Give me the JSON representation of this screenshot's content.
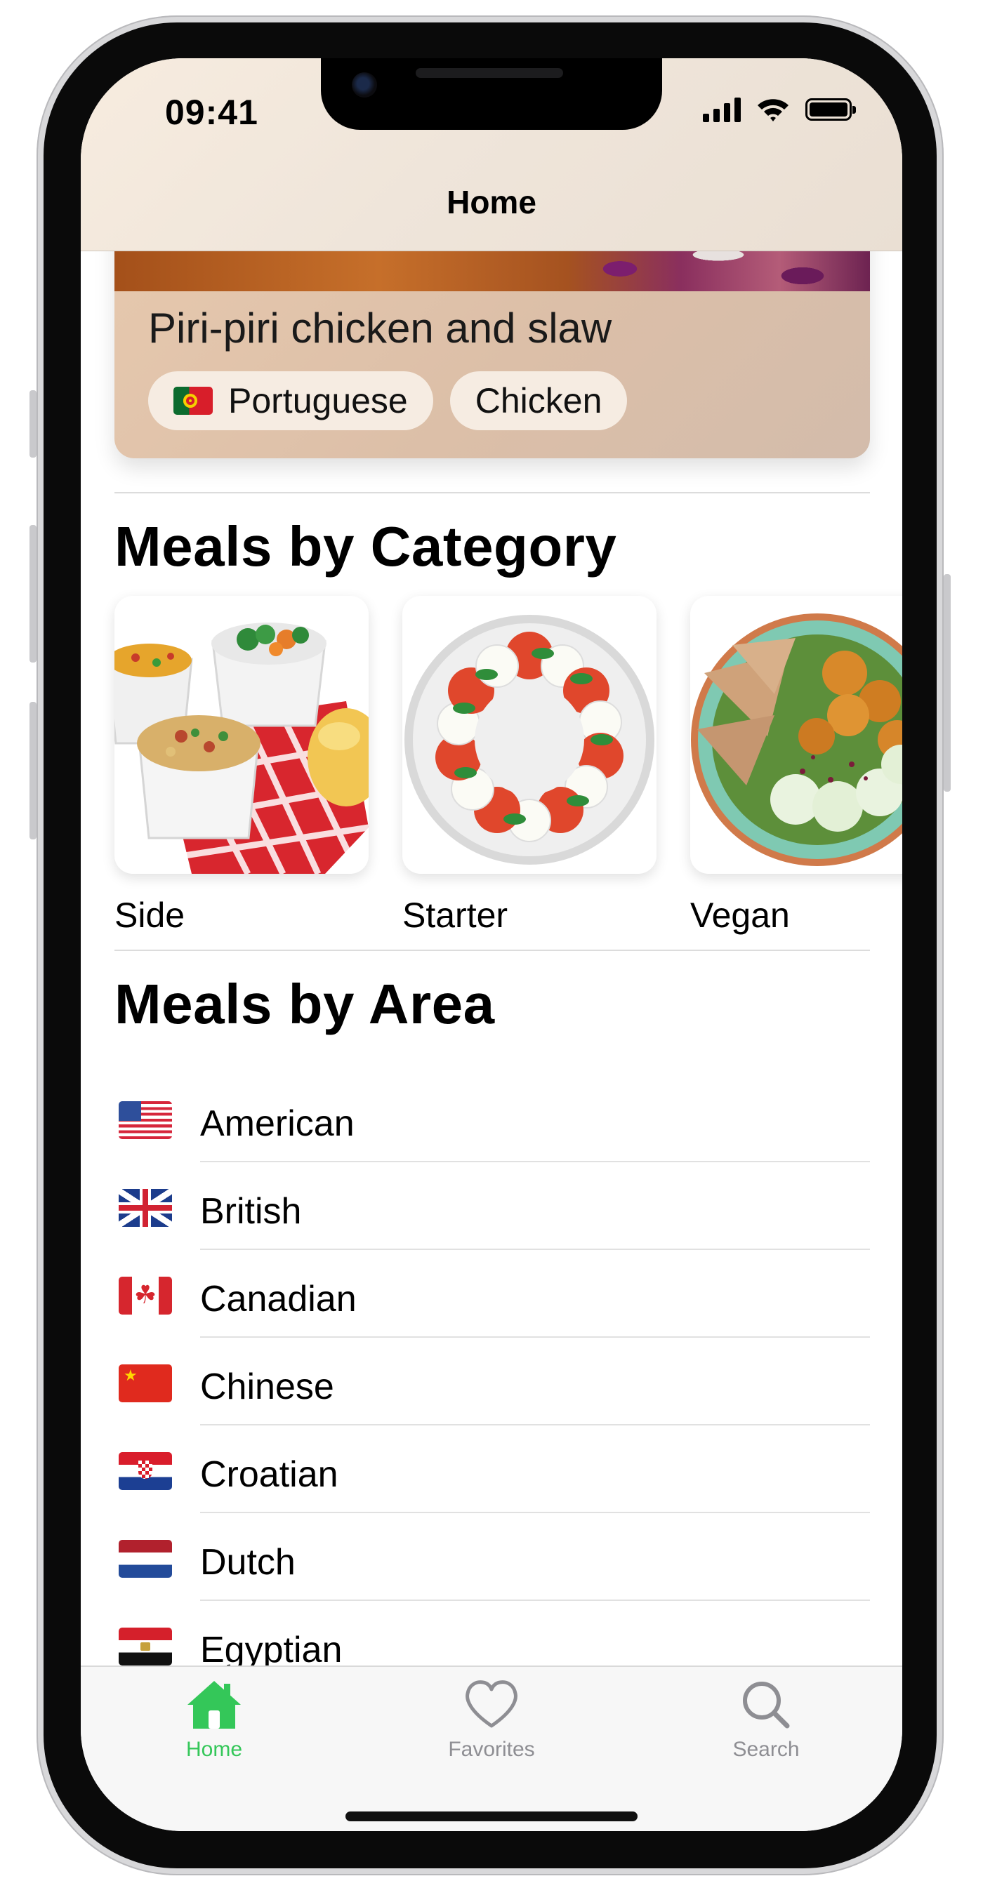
{
  "status_bar": {
    "time": "09:41"
  },
  "nav": {
    "title": "Home"
  },
  "featured": {
    "title": "Piri-piri chicken and slaw",
    "tags": [
      {
        "icon": "portugal-flag-icon",
        "label": "Portuguese"
      },
      {
        "label": "Chicken"
      }
    ]
  },
  "categories": {
    "title": "Meals by Category",
    "items": [
      {
        "label": "Side"
      },
      {
        "label": "Starter"
      },
      {
        "label": "Vegan"
      }
    ]
  },
  "areas": {
    "title": "Meals by Area",
    "items": [
      {
        "label": "American",
        "flag": "us-flag-icon"
      },
      {
        "label": "British",
        "flag": "uk-flag-icon"
      },
      {
        "label": "Canadian",
        "flag": "canada-flag-icon"
      },
      {
        "label": "Chinese",
        "flag": "china-flag-icon"
      },
      {
        "label": "Croatian",
        "flag": "croatia-flag-icon"
      },
      {
        "label": "Dutch",
        "flag": "netherlands-flag-icon"
      },
      {
        "label": "Egyptian",
        "flag": "egypt-flag-icon"
      }
    ]
  },
  "tabbar": {
    "home": "Home",
    "favorites": "Favorites",
    "search": "Search",
    "active_color": "#34c759",
    "inactive_color": "#8e8e93"
  }
}
